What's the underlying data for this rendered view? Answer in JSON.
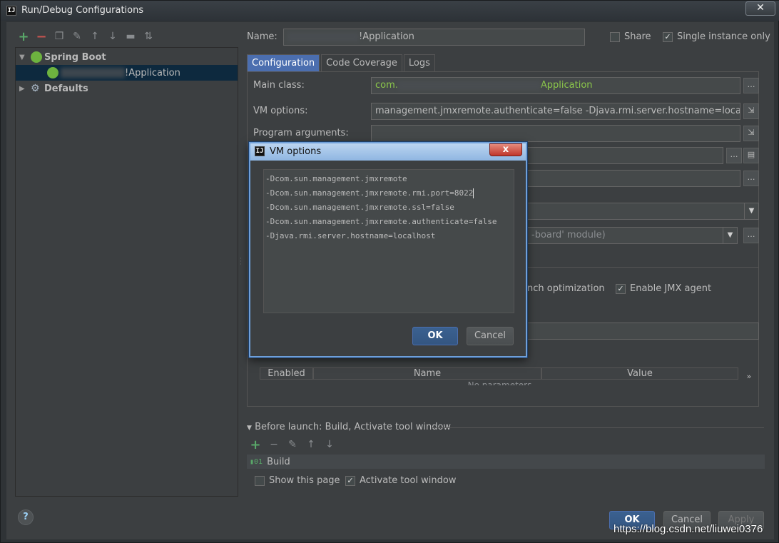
{
  "window": {
    "title": "Run/Debug Configurations",
    "close": "✕"
  },
  "left": {
    "toolbar": [
      "+",
      "−",
      "copy",
      "wrench",
      "up",
      "down",
      "folder",
      "sort"
    ],
    "tree": {
      "spring_boot_label": "Spring Boot",
      "app_label": "!Application",
      "defaults_label": "Defaults"
    }
  },
  "form": {
    "name_label": "Name:",
    "name_value": "!Application",
    "share_label": "Share",
    "single_instance_label": "Single instance only",
    "tabs": [
      "Configuration",
      "Code Coverage",
      "Logs"
    ],
    "main_class_label": "Main class:",
    "main_class_prefix": "com.",
    "main_class_suffix": "Application",
    "vm_options_label": "VM options:",
    "vm_options_value": "management.jmxremote.authenticate=false -Djava.rmi.server.hostname=localhost",
    "program_args_label": "Program arguments:",
    "module_text": "-board' module)",
    "launch_opt_label": "nch optimization",
    "enable_jmx_label": "Enable JMX agent",
    "env_columns": [
      "Enabled",
      "Name",
      "Value"
    ],
    "env_empty": "No parameters",
    "more_label": "»"
  },
  "before_launch": {
    "title": "Before launch: Build, Activate tool window",
    "build_item": "Build",
    "show_page_label": "Show this page",
    "activate_label": "Activate tool window"
  },
  "buttons": {
    "ok": "OK",
    "cancel": "Cancel",
    "apply": "Apply",
    "help": "?"
  },
  "modal": {
    "title": "VM options",
    "close": "x",
    "lines": [
      "-Dcom.sun.management.jmxremote",
      "-Dcom.sun.management.jmxremote.rmi.port=8022",
      "-Dcom.sun.management.jmxremote.ssl=false",
      "-Dcom.sun.management.jmxremote.authenticate=false",
      "-Djava.rmi.server.hostname=localhost"
    ],
    "ok": "OK",
    "cancel": "Cancel"
  },
  "watermark": "https://blog.csdn.net/liuwei0376"
}
